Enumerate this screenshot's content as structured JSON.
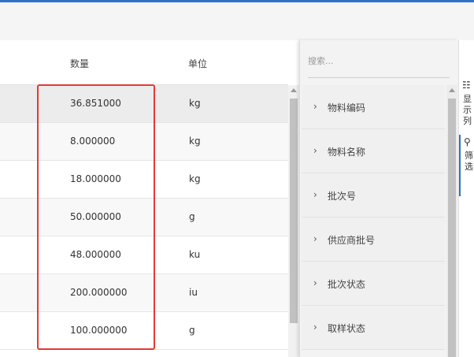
{
  "table": {
    "headers": {
      "quantity": "数量",
      "unit": "单位"
    },
    "rows": [
      {
        "quantity": "36.851000",
        "unit": "kg"
      },
      {
        "quantity": "8.000000",
        "unit": "kg"
      },
      {
        "quantity": "18.000000",
        "unit": "kg"
      },
      {
        "quantity": "50.000000",
        "unit": "g"
      },
      {
        "quantity": "48.000000",
        "unit": "ku"
      },
      {
        "quantity": "200.000000",
        "unit": "iu"
      },
      {
        "quantity": "100.000000",
        "unit": "g"
      }
    ]
  },
  "side_panel": {
    "search_placeholder": "搜索...",
    "items": [
      {
        "label": "物料编码"
      },
      {
        "label": "物料名称"
      },
      {
        "label": "批次号"
      },
      {
        "label": "供应商批号"
      },
      {
        "label": "批次状态"
      },
      {
        "label": "取样状态"
      }
    ]
  },
  "tabs": {
    "columns_label": "显示列",
    "filter_label": "筛选"
  },
  "colors": {
    "accent": "#2f73c9",
    "highlight": "#e53935"
  }
}
